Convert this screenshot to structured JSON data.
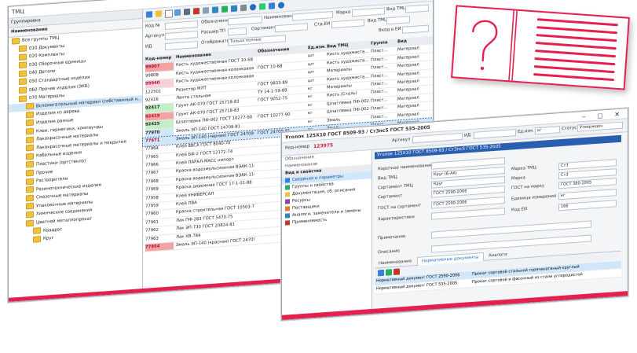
{
  "back_window": {
    "title": "ТМЦ",
    "tree": {
      "header": "Группировка",
      "column": "Наименование",
      "items": [
        "Все группы ТМЦ",
        "010 Документы",
        "020 Комплекты",
        "030 Сборочные единицы",
        "040 Детали",
        "050 Стандартные изделия",
        "060 Прочие изделия (ЭКБ)",
        "070 Материалы",
        "Вспомогательный материал (собственный н...",
        "Изделия из дерева",
        "Изделия разные",
        "Клеи, герметики, компаунды",
        "Лакокрасочные материалы",
        "Лакокрасочные материалы и покрытия",
        "Кабельные изделия",
        "Пластики (оргстекло)",
        "Прочие",
        "Растворители",
        "Резинотехнические изделия",
        "Смазочные материалы",
        "Упаковочные материалы",
        "Химические соединения",
        "Цветной металлопрокат",
        "Квадрат",
        "Круг"
      ]
    },
    "filters": {
      "labels": [
        "Обозначение",
        "Наименование",
        "Марка",
        "Вид ТМЦ",
        "Вид ТМЦ",
        "Сортамент",
        "Расшир.ТП",
        "Отображать",
        "Только полные",
        "Стд.ЕИ",
        "Вход в ЕИ"
      ],
      "side_labels": [
        "Код №",
        "Артикул",
        "ИД"
      ]
    },
    "grid": {
      "headers": [
        "Код-номер",
        "Наименование",
        "Обозначение",
        "Ед.изм.",
        "Вид ТМЦ",
        "Группа",
        "Вид"
      ],
      "rows": [
        {
          "code": "99807",
          "name": "Кисть художественная ГОСТ 10-68",
          "des": "",
          "unit": "шт",
          "kind": "Кисть художеств...",
          "grp": "Пласт...",
          "type": "Материал",
          "hl": "red"
        },
        {
          "code": "99808",
          "name": "Кисть художественная колонковая №1",
          "des": "ГОСТ 10-68",
          "unit": "шт",
          "kind": "Кисть художеств...",
          "grp": "Пласт...",
          "type": "Материал",
          "hl": ""
        },
        {
          "code": "99940",
          "name": "Кисть художественная колонковая №2",
          "des": "",
          "unit": "шт",
          "kind": "Материалы",
          "grp": "Пласт...",
          "type": "Материал",
          "hl": "pink"
        },
        {
          "code": "122501",
          "name": "Резистор МЛТ",
          "des": "ГОСТ 9833-89",
          "unit": "шт",
          "kind": "Кисть художеств...",
          "grp": "Пласт...",
          "type": "Материал",
          "hl": ""
        },
        {
          "code": "92416",
          "name": "Лента стальная",
          "des": "ТУ 14-1-59-89",
          "unit": "кг",
          "kind": "Материалы",
          "grp": "Пласт...",
          "type": "Материал",
          "hl": ""
        },
        {
          "code": "92417",
          "name": "Грунт АК-070 ГОСТ 25718-83",
          "des": "ГОСТ 9052-75",
          "unit": "кг",
          "kind": "Кисть (Сталь)",
          "grp": "Пласт...",
          "type": "Материал",
          "hl": "green"
        },
        {
          "code": "92419",
          "name": "Грунт АК-070 ГОСТ 25718-83",
          "des": "",
          "unit": "кг",
          "kind": "Шпатлевка ПФ-002",
          "grp": "Пласт...",
          "type": "Материал",
          "hl": "red"
        },
        {
          "code": "92425",
          "name": "Шпатлевка ПФ-002 ГОСТ 10277-90",
          "des": "ГОСТ 10277-90",
          "unit": "кг",
          "kind": "Шпатлевка ПФ-002",
          "grp": "Пласт...",
          "type": "Материал",
          "hl": "green"
        },
        {
          "code": "77970",
          "name": "Эмаль ЭП-140 ГОСТ 24709-81",
          "des": "",
          "unit": "кг",
          "kind": "Эмаль",
          "grp": "Пласт...",
          "type": "Материал",
          "hl": "blue"
        },
        {
          "code": "77971",
          "name": "Эмаль ЭП-140 (черная) ГОСТ 24709-81",
          "des": "ГОСТ 24709-81",
          "unit": "кг",
          "kind": "Эмаль",
          "grp": "Пласт...",
          "type": "Материал",
          "hl": "sel"
        },
        {
          "code": "77964",
          "name": "Клей 88СА ГОСТ 8040-70",
          "des": "",
          "unit": "кг",
          "kind": "",
          "grp": "",
          "type": "",
          "hl": ""
        },
        {
          "code": "77965",
          "name": "Клей БФ-2 ГОСТ 12172-74",
          "des": "",
          "unit": "кг",
          "kind": "",
          "grp": "",
          "type": "",
          "hl": ""
        },
        {
          "code": "77966",
          "name": "Клей ПАРАЛ-МАСС импорт",
          "des": "",
          "unit": "кг",
          "kind": "",
          "grp": "",
          "type": "",
          "hl": ""
        },
        {
          "code": "77967",
          "name": "Краска водоэмульсионная ВЭАК-1180",
          "des": "",
          "unit": "кг",
          "kind": "",
          "grp": "",
          "type": "",
          "hl": ""
        },
        {
          "code": "77968",
          "name": "Краска водоэмульсионная ВЭАК-1180",
          "des": "",
          "unit": "кг",
          "kind": "",
          "grp": "",
          "type": "",
          "hl": ""
        },
        {
          "code": "77969",
          "name": "Краска дорожная ГОСТ 17-1-01-88",
          "des": "",
          "unit": "кг",
          "kind": "",
          "grp": "",
          "type": "",
          "hl": ""
        },
        {
          "code": "77958",
          "name": "Клей УНИВЕРСАЛ",
          "des": "",
          "unit": "кг",
          "kind": "",
          "grp": "",
          "type": "",
          "hl": ""
        },
        {
          "code": "77959",
          "name": "Клей ПВА",
          "des": "",
          "unit": "кг",
          "kind": "",
          "grp": "",
          "type": "",
          "hl": ""
        },
        {
          "code": "77960",
          "name": "Краска строительная ГОСТ 10503-71",
          "des": "",
          "unit": "кг",
          "kind": "",
          "grp": "",
          "type": "",
          "hl": ""
        },
        {
          "code": "77961",
          "name": "Лак ПФ-283 ГОСТ 5470-75",
          "des": "",
          "unit": "кг",
          "kind": "",
          "grp": "",
          "type": "",
          "hl": ""
        },
        {
          "code": "77962",
          "name": "Лак ЭП-730 ГОСТ 20824-81",
          "des": "",
          "unit": "кг",
          "kind": "",
          "grp": "",
          "type": "",
          "hl": ""
        },
        {
          "code": "77963",
          "name": "Лак ХВ-784",
          "des": "",
          "unit": "кг",
          "kind": "",
          "grp": "",
          "type": "",
          "hl": ""
        },
        {
          "code": "77954",
          "name": "Эмаль ЭП-140 (красная) ГОСТ 24709-81",
          "des": "",
          "unit": "кг",
          "kind": "",
          "grp": "",
          "type": "",
          "hl": "red"
        }
      ]
    }
  },
  "front_window": {
    "title": "Уголок 125Х10 ГОСТ 8509-93 / Ст3пс5 ГОСТ 535-2005",
    "code": "123975",
    "left_labels": [
      "Код-номер",
      "Обозначение",
      "Наименование"
    ],
    "nav_header": "Вид и свойства",
    "nav_items": [
      "Сведения и параметры",
      "Группы и свойства",
      "Документация, сб. описания",
      "Ресурсы",
      "Поставщики",
      "Аналоги, заменители и замены",
      "Применяемость"
    ],
    "fields": [
      {
        "label": "Короткое наименование",
        "value": ""
      },
      {
        "label": "Вид ТМЦ",
        "value": "Круг (Б-АА)"
      },
      {
        "label": "Сортамент ТМЦ",
        "value": "Круг"
      },
      {
        "label": "Сортамент",
        "value": "ГОСТ 2590-2006"
      },
      {
        "label": "ГОСТ на сортамент",
        "value": "ГОСТ 2590-2006"
      },
      {
        "label": "Характеристики",
        "value": ""
      },
      {
        "label": "Примечание",
        "value": ""
      },
      {
        "label": "Описание",
        "value": ""
      }
    ],
    "right_fields": [
      {
        "label": "Марка ТМЦ",
        "value": "Ст3"
      },
      {
        "label": "Марка",
        "value": "Ст3"
      },
      {
        "label": "ГОСТ на марку",
        "value": "ГОСТ 380-2005"
      },
      {
        "label": "Единица измерения",
        "value": "кг"
      },
      {
        "label": "Код ЕИ",
        "value": "166"
      }
    ],
    "top_fields": {
      "article_label": "Артикул",
      "id_label": "ИД",
      "unit_label": "Ед.изм.",
      "unit_value": "кг",
      "status_label": "Статус",
      "status_value": "Утвержден"
    },
    "tabs": [
      "Наименования",
      "Нормативные документы",
      "Аналоги"
    ],
    "active_tab": 1,
    "doc_rows": [
      {
        "kind": "Нормативный документ",
        "number": "ГОСТ 2590-2006",
        "name": "Прокат сортовой стальной горячекатаный круглый"
      },
      {
        "kind": "Нормативный документ",
        "number": "ГОСТ 535-2005",
        "name": "Прокат сортовой и фасонный из стали углеродистой"
      }
    ]
  },
  "colors": {
    "accent": "#e4204f",
    "selection": "#cfe6fb",
    "highlight_red": "#f08c8c",
    "highlight_green": "#bff0bf",
    "link": "#1f6fc5"
  }
}
